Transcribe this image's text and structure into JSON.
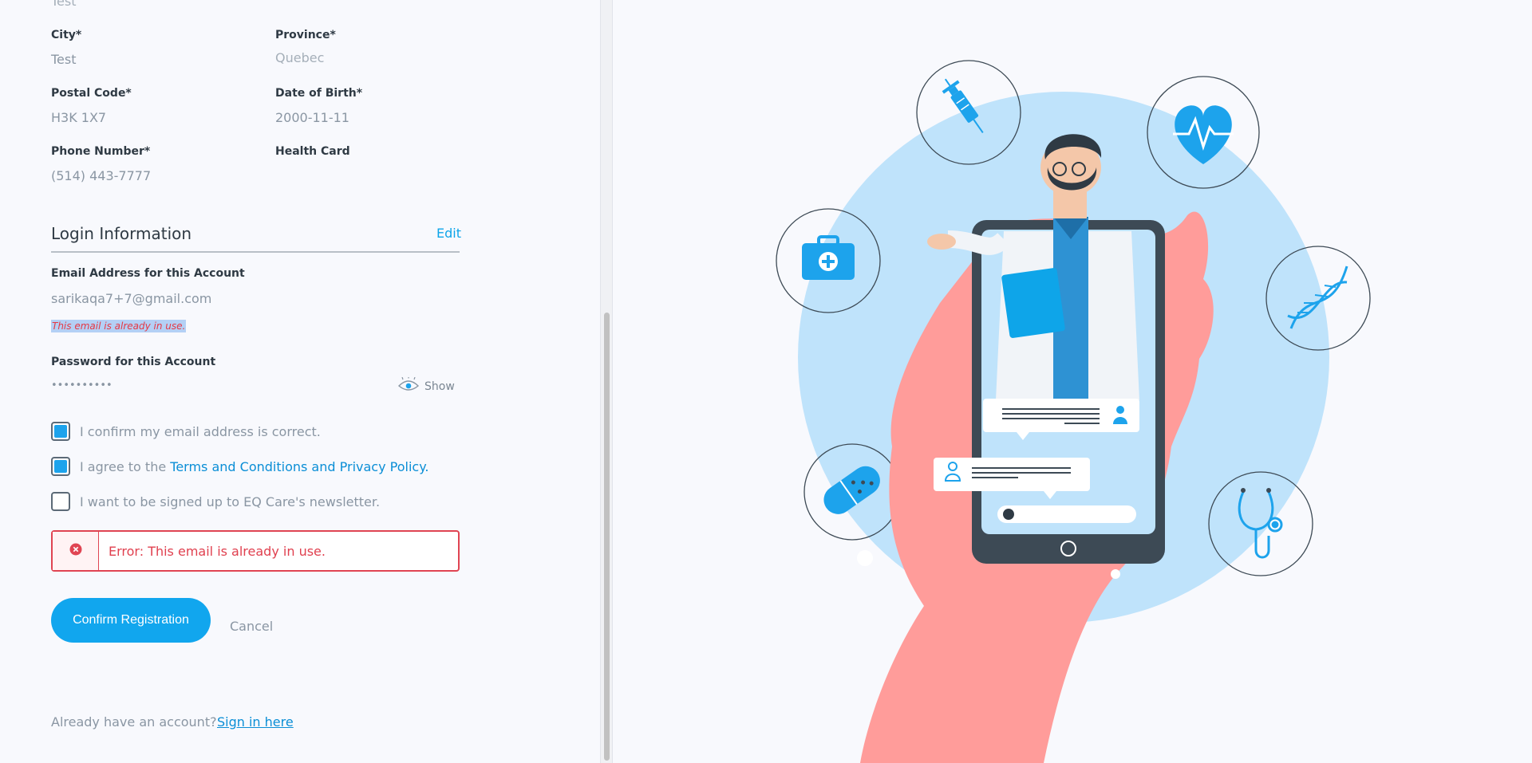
{
  "profile": {
    "top_value": "Test",
    "city_label": "City*",
    "city_value": "Test",
    "province_label": "Province*",
    "province_value": "Quebec",
    "postal_label": "Postal Code*",
    "postal_value": "H3K 1X7",
    "dob_label": "Date of Birth*",
    "dob_value": "2000-11-11",
    "phone_label": "Phone Number*",
    "phone_value": "(514) 443-7777",
    "health_label": "Health Card"
  },
  "login": {
    "title": "Login Information",
    "edit_label": "Edit",
    "email_label": "Email Address for this Account",
    "email_value": "sarikaqa7+7@gmail.com",
    "email_error": "This email is already in use.",
    "password_label": "Password for this Account",
    "password_value": "••••••••••",
    "show_label": "Show"
  },
  "checks": {
    "confirm_email": "I confirm my email address is correct.",
    "agree_prefix": "I agree to the ",
    "agree_link": "Terms and Conditions and Privacy Policy",
    "agree_suffix": ".",
    "newsletter": "I want to be signed up to EQ Care's newsletter.",
    "confirm_email_checked": true,
    "agree_checked": true,
    "newsletter_checked": false
  },
  "error": {
    "message": "Error: This email is already in use."
  },
  "actions": {
    "confirm_label": "Confirm Registration",
    "cancel_label": "Cancel"
  },
  "footer": {
    "prompt": "Already have an account?",
    "signin_label": "Sign in here"
  },
  "colors": {
    "accent": "#11a6ee",
    "error": "#e04452",
    "illustration_circle": "#bfe3fb",
    "hand": "#ff9c9a"
  }
}
